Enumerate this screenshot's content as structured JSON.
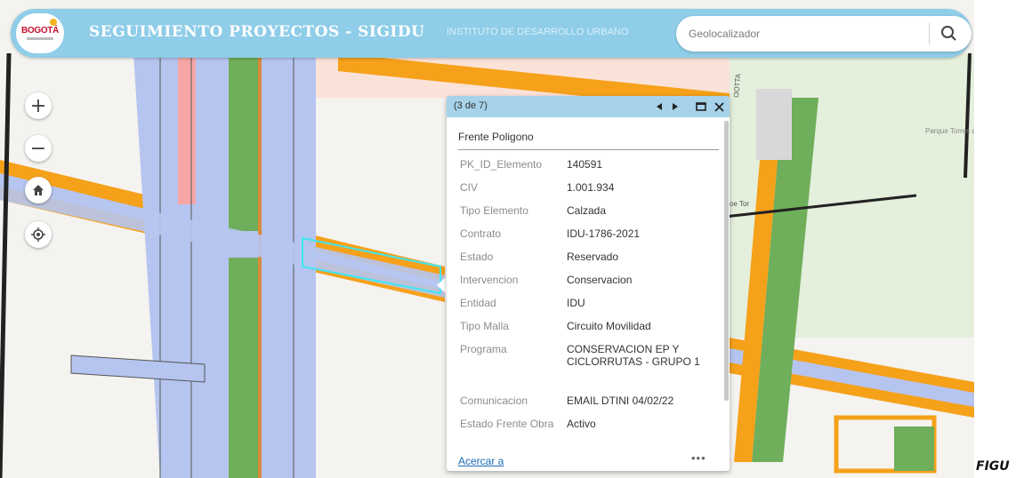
{
  "header": {
    "logo_text": "BOGOTÁ",
    "title": "SEGUIMIENTO PROYECTOS - SIGIDU",
    "subtitle": "INSTITUTO DE DESARROLLO URBANO"
  },
  "search": {
    "placeholder": "Geolocalizador",
    "icon": "search-icon"
  },
  "map_controls": [
    {
      "name": "zoom-in-button",
      "label": "+"
    },
    {
      "name": "zoom-out-button",
      "label": "−"
    },
    {
      "name": "home-button",
      "icon": "home-icon"
    },
    {
      "name": "locate-button",
      "icon": "locate-icon"
    }
  ],
  "map_labels": {
    "park": "Parque Torres de Madeira",
    "street_fragment": "oe Tor",
    "street_vertical": "OOTTA"
  },
  "popup": {
    "count": "(3 de 7)",
    "title": "Frente Poligono",
    "rows": [
      {
        "key": "PK_ID_Elemento",
        "value": "140591"
      },
      {
        "key": "CIV",
        "value": "1.001.934"
      },
      {
        "key": "Tipo Elemento",
        "value": "Calzada"
      },
      {
        "key": "Contrato",
        "value": "IDU-1786-2021"
      },
      {
        "key": "Estado",
        "value": "Reservado"
      },
      {
        "key": "Intervencion",
        "value": "Conservacion"
      },
      {
        "key": "Entidad",
        "value": "IDU"
      },
      {
        "key": "Tipo Malla",
        "value": "Circuito Movilidad"
      },
      {
        "key": "Programa",
        "value": "CONSERVACION EP Y CICLORRUTAS - GRUPO 1"
      },
      {
        "key": "Comunicacion",
        "value": "EMAIL DTINI 04/02/22"
      },
      {
        "key": "Estado Frente Obra",
        "value": "Activo"
      }
    ],
    "zoom_link": "Acercar a",
    "more": "•••"
  },
  "caption": "FIGU",
  "colors": {
    "header": "#8fcde8",
    "road": "#b6c5ef",
    "curb": "#f6a11a",
    "median": "#6fae5a",
    "highlight": "#3fe6f0"
  }
}
